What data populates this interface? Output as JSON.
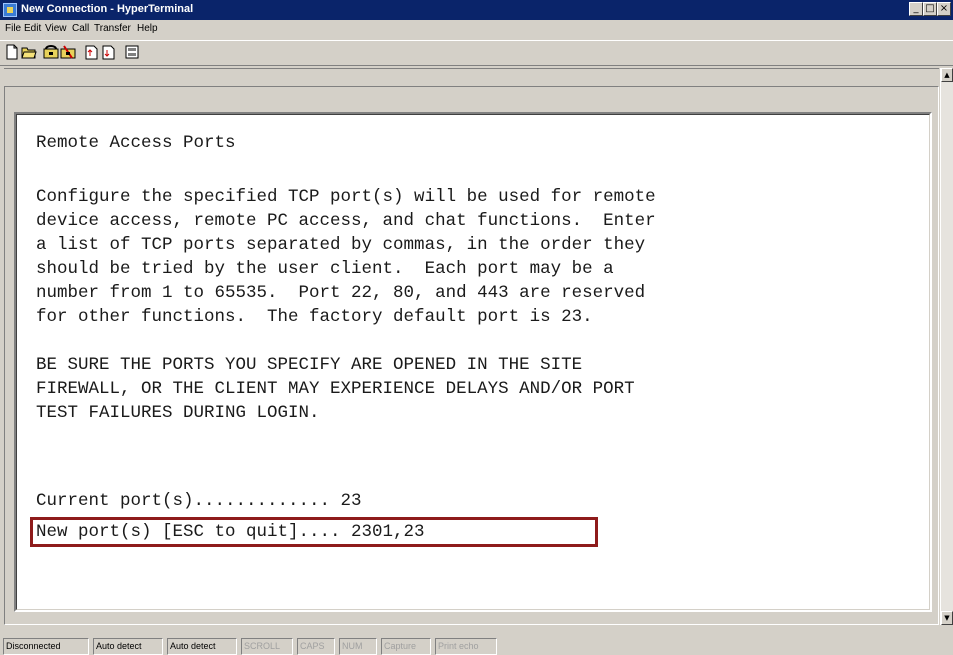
{
  "window": {
    "title": "New Connection - HyperTerminal",
    "buttons": [
      "_",
      "□",
      "×"
    ]
  },
  "menubar": {
    "items": [
      "File",
      "Edit",
      "View",
      "Call",
      "Transfer",
      "Help"
    ]
  },
  "toolbar": {
    "buttons": [
      "new-icon",
      "open-icon",
      "call-icon",
      "disconnect-icon",
      "send-icon",
      "receive-icon",
      "properties-icon"
    ]
  },
  "terminal": {
    "lines": [
      "Remote Access Ports",
      "",
      "Configure the specified TCP port(s) will be used for remote",
      "device access, remote PC access, and chat functions.  Enter",
      "a list of TCP ports separated by commas, in the order they",
      "should be tried by the user client.  Each port may be a",
      "number from 1 to 65535.  Port 22, 80, and 443 are reserved",
      "for other functions.  The factory default port is 23.",
      "",
      "BE SURE THE PORTS YOU SPECIFY ARE OPENED IN THE SITE",
      "FIREWALL, OR THE CLIENT MAY EXPERIENCE DELAYS AND/OR PORT",
      "TEST FAILURES DURING LOGIN.",
      "",
      "Current port(s)............. 23",
      "New port(s) [ESC to quit].... 2301,23"
    ]
  },
  "statusbar": {
    "panels": [
      "Disconnected",
      "Auto detect",
      "Auto detect",
      "SCROLL",
      "CAPS",
      "NUM",
      "Capture",
      "Print echo"
    ]
  },
  "colors": {
    "titlebar": "#0a246a",
    "highlight_border": "#8e1b1b",
    "chrome": "#d4d0c8"
  }
}
